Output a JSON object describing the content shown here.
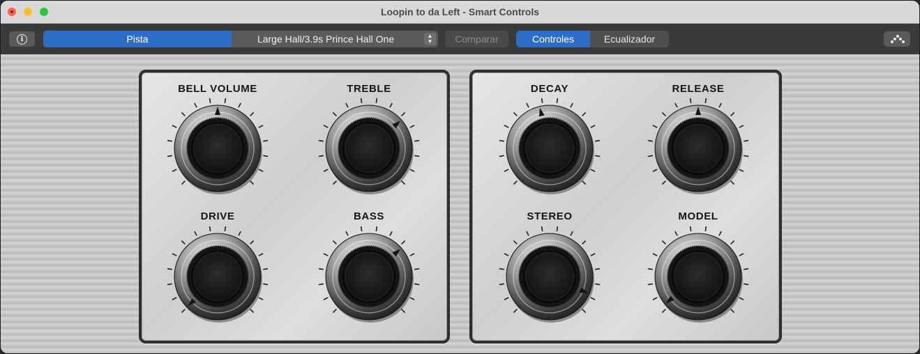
{
  "window": {
    "title": "Loopin to da Left - Smart Controls"
  },
  "toolbar": {
    "info_icon": "info-icon",
    "track_label": "Pista",
    "preset_name": "Large Hall/3.9s Prince Hall One",
    "compare_label": "Comparar",
    "controls_label": "Controles",
    "eq_label": "Ecualizador",
    "network_icon": "network-icon"
  },
  "knobs": [
    {
      "id": "bell-volume",
      "label": "BELL VOLUME",
      "value": 0.5
    },
    {
      "id": "treble",
      "label": "TREBLE",
      "value": 0.68
    },
    {
      "id": "drive",
      "label": "DRIVE",
      "value": 0.0
    },
    {
      "id": "bass",
      "label": "BASS",
      "value": 0.68
    },
    {
      "id": "decay",
      "label": "DECAY",
      "value": 0.45
    },
    {
      "id": "release",
      "label": "RELEASE",
      "value": 0.5
    },
    {
      "id": "stereo",
      "label": "STEREO",
      "value": 0.92
    },
    {
      "id": "model",
      "label": "MODEL",
      "value": 0.02
    }
  ],
  "colors": {
    "accent": "#2e6dc6",
    "close": "#ff5f57",
    "minimize": "#febc2e",
    "maximize": "#28c840"
  }
}
